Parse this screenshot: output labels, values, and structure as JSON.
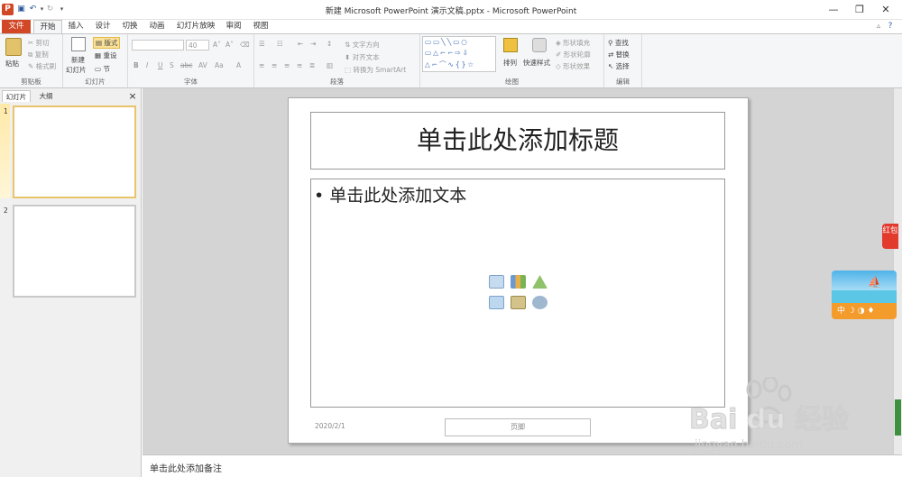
{
  "window": {
    "title": "新建 Microsoft PowerPoint 演示文稿.pptx - Microsoft PowerPoint",
    "app_icon": "P",
    "controls": {
      "minimize": "—",
      "restore": "❐",
      "close": "✕"
    }
  },
  "tabs": [
    {
      "label": "文件"
    },
    {
      "label": "开始"
    },
    {
      "label": "插入"
    },
    {
      "label": "设计"
    },
    {
      "label": "切换"
    },
    {
      "label": "动画"
    },
    {
      "label": "幻灯片放映"
    },
    {
      "label": "审阅"
    },
    {
      "label": "视图"
    }
  ],
  "ribbon": {
    "clipboard": {
      "label": "剪贴板",
      "paste": "粘贴",
      "cut": "剪切",
      "copy": "复制",
      "format_painter": "格式刷"
    },
    "slides": {
      "label": "幻灯片",
      "new_slide_1": "新建",
      "new_slide_2": "幻灯片",
      "layout": "版式",
      "reset": "重设",
      "section": "节"
    },
    "font": {
      "label": "字体",
      "size": "40"
    },
    "paragraph": {
      "label": "段落",
      "text_direction": "文字方向",
      "align_text": "对齐文本",
      "smartart": "转换为 SmartArt"
    },
    "drawing": {
      "label": "绘图",
      "arrange": "排列",
      "quick_styles": "快速样式",
      "shape_fill": "形状填充",
      "shape_outline": "形状轮廓",
      "shape_effects": "形状效果"
    },
    "editing": {
      "label": "编辑",
      "find": "查找",
      "replace": "替换",
      "select": "选择"
    }
  },
  "left_panel": {
    "tabs": [
      "幻灯片",
      "大纲"
    ],
    "close": "×",
    "slides": [
      {
        "number": "1"
      },
      {
        "number": "2"
      }
    ]
  },
  "slide": {
    "title_placeholder": "单击此处添加标题",
    "body_placeholder": "单击此处添加文本",
    "bullet": "•",
    "date": "2020/2/1",
    "footer": "页脚"
  },
  "notes": {
    "placeholder": "单击此处添加备注"
  },
  "overlays": {
    "hongbao": "红包",
    "beach_widget": "中",
    "watermark_brand": "Bai du 经验",
    "watermark_url": "jingyan.baidu.com"
  },
  "colors": {
    "file_tab": "#d24726",
    "accent": "#2b579a",
    "hongbao": "#e23b2e"
  }
}
